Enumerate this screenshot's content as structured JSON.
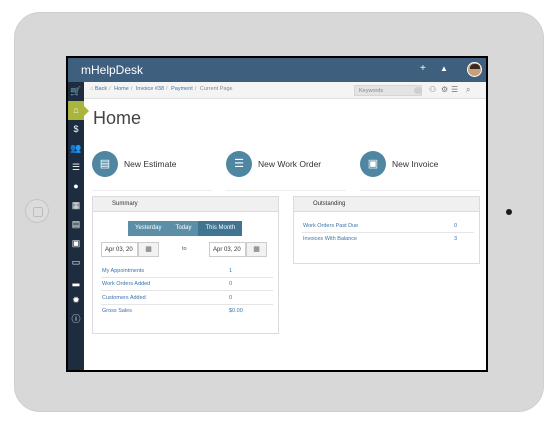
{
  "app": {
    "title": "mHelpDesk"
  },
  "topbar": {
    "icons": [
      "plus-icon",
      "bell-icon",
      "user-avatar"
    ]
  },
  "sidebar": {
    "items": [
      {
        "icon": "cart-icon",
        "glyph": "🛒"
      },
      {
        "icon": "home-icon",
        "glyph": "⌂",
        "active": true
      },
      {
        "icon": "dollar-icon",
        "glyph": "$"
      },
      {
        "icon": "users-icon",
        "glyph": "👥"
      },
      {
        "icon": "list-icon",
        "glyph": "☰"
      },
      {
        "icon": "map-pin-icon",
        "glyph": "●"
      },
      {
        "icon": "calendar-icon",
        "glyph": "▦"
      },
      {
        "icon": "calculator-icon",
        "glyph": "▤"
      },
      {
        "icon": "money-icon",
        "glyph": "▣"
      },
      {
        "icon": "credit-card-icon",
        "glyph": "▭"
      },
      {
        "icon": "bar-chart-icon",
        "glyph": "▂"
      },
      {
        "icon": "gear-icon",
        "glyph": "✹"
      },
      {
        "icon": "info-icon",
        "glyph": "ⓘ"
      }
    ]
  },
  "breadcrumb": {
    "back": "Back",
    "home": "Home",
    "invoice": "Invoice #38",
    "payment": "Payment",
    "current": "Current Page"
  },
  "search": {
    "placeholder": "Keywords"
  },
  "page": {
    "title": "Home"
  },
  "actions": {
    "new_estimate": "New Estimate",
    "new_work_order": "New Work Order",
    "new_invoice": "New Invoice"
  },
  "summary": {
    "title": "Summary",
    "ranges": [
      "Yesterday",
      "Today",
      "This Month"
    ],
    "selected_range": "This Month",
    "date_from": "Apr 03, 20",
    "date_to": "Apr 03, 20",
    "to_label": "to",
    "rows": [
      {
        "label": "My Appointments",
        "value": "1"
      },
      {
        "label": "Work Orders Added",
        "value": "0"
      },
      {
        "label": "Customers Added",
        "value": "0"
      },
      {
        "label": "Gross Sales",
        "value": "$0.00"
      }
    ]
  },
  "outstanding": {
    "title": "Outstanding",
    "rows": [
      {
        "label": "Work Orders Past Due",
        "value": "0"
      },
      {
        "label": "Invoices With Balance",
        "value": "3"
      }
    ]
  },
  "colors": {
    "topbar": "#3f5f7e",
    "sidebar": "#1d2d3f",
    "active": "#a9b53d",
    "accent": "#4f86a1",
    "link": "#3a73a8"
  }
}
